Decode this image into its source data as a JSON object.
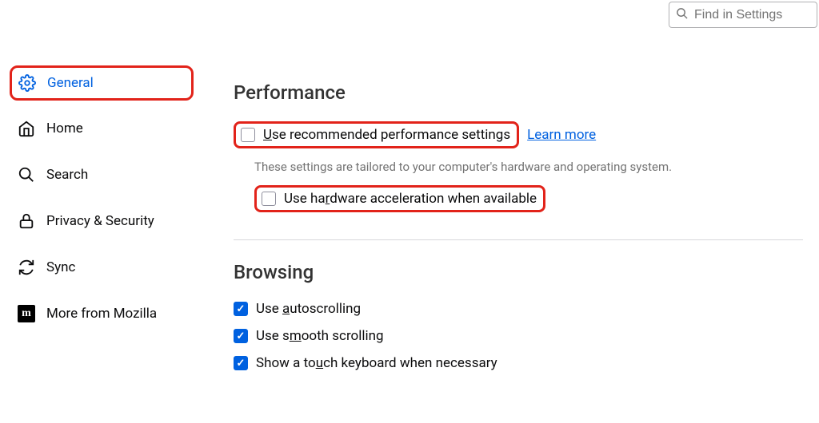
{
  "search": {
    "placeholder": "Find in Settings"
  },
  "sidebar": {
    "items": [
      {
        "label": "General"
      },
      {
        "label": "Home"
      },
      {
        "label": "Search"
      },
      {
        "label": "Privacy & Security"
      },
      {
        "label": "Sync"
      },
      {
        "label": "More from Mozilla"
      }
    ]
  },
  "performance": {
    "title": "Performance",
    "recommended_pre": "",
    "recommended_u": "U",
    "recommended_post": "se recommended performance settings",
    "learn_more": "Learn more",
    "desc": "These settings are tailored to your computer's hardware and operating system.",
    "hw_pre": "Use ha",
    "hw_u": "r",
    "hw_post": "dware acceleration when available"
  },
  "browsing": {
    "title": "Browsing",
    "auto_pre": "Use ",
    "auto_u": "a",
    "auto_post": "utoscrolling",
    "smooth_pre": "Use s",
    "smooth_u": "m",
    "smooth_post": "ooth scrolling",
    "touch_pre": "Show a to",
    "touch_u": "u",
    "touch_post": "ch keyboard when necessary"
  }
}
